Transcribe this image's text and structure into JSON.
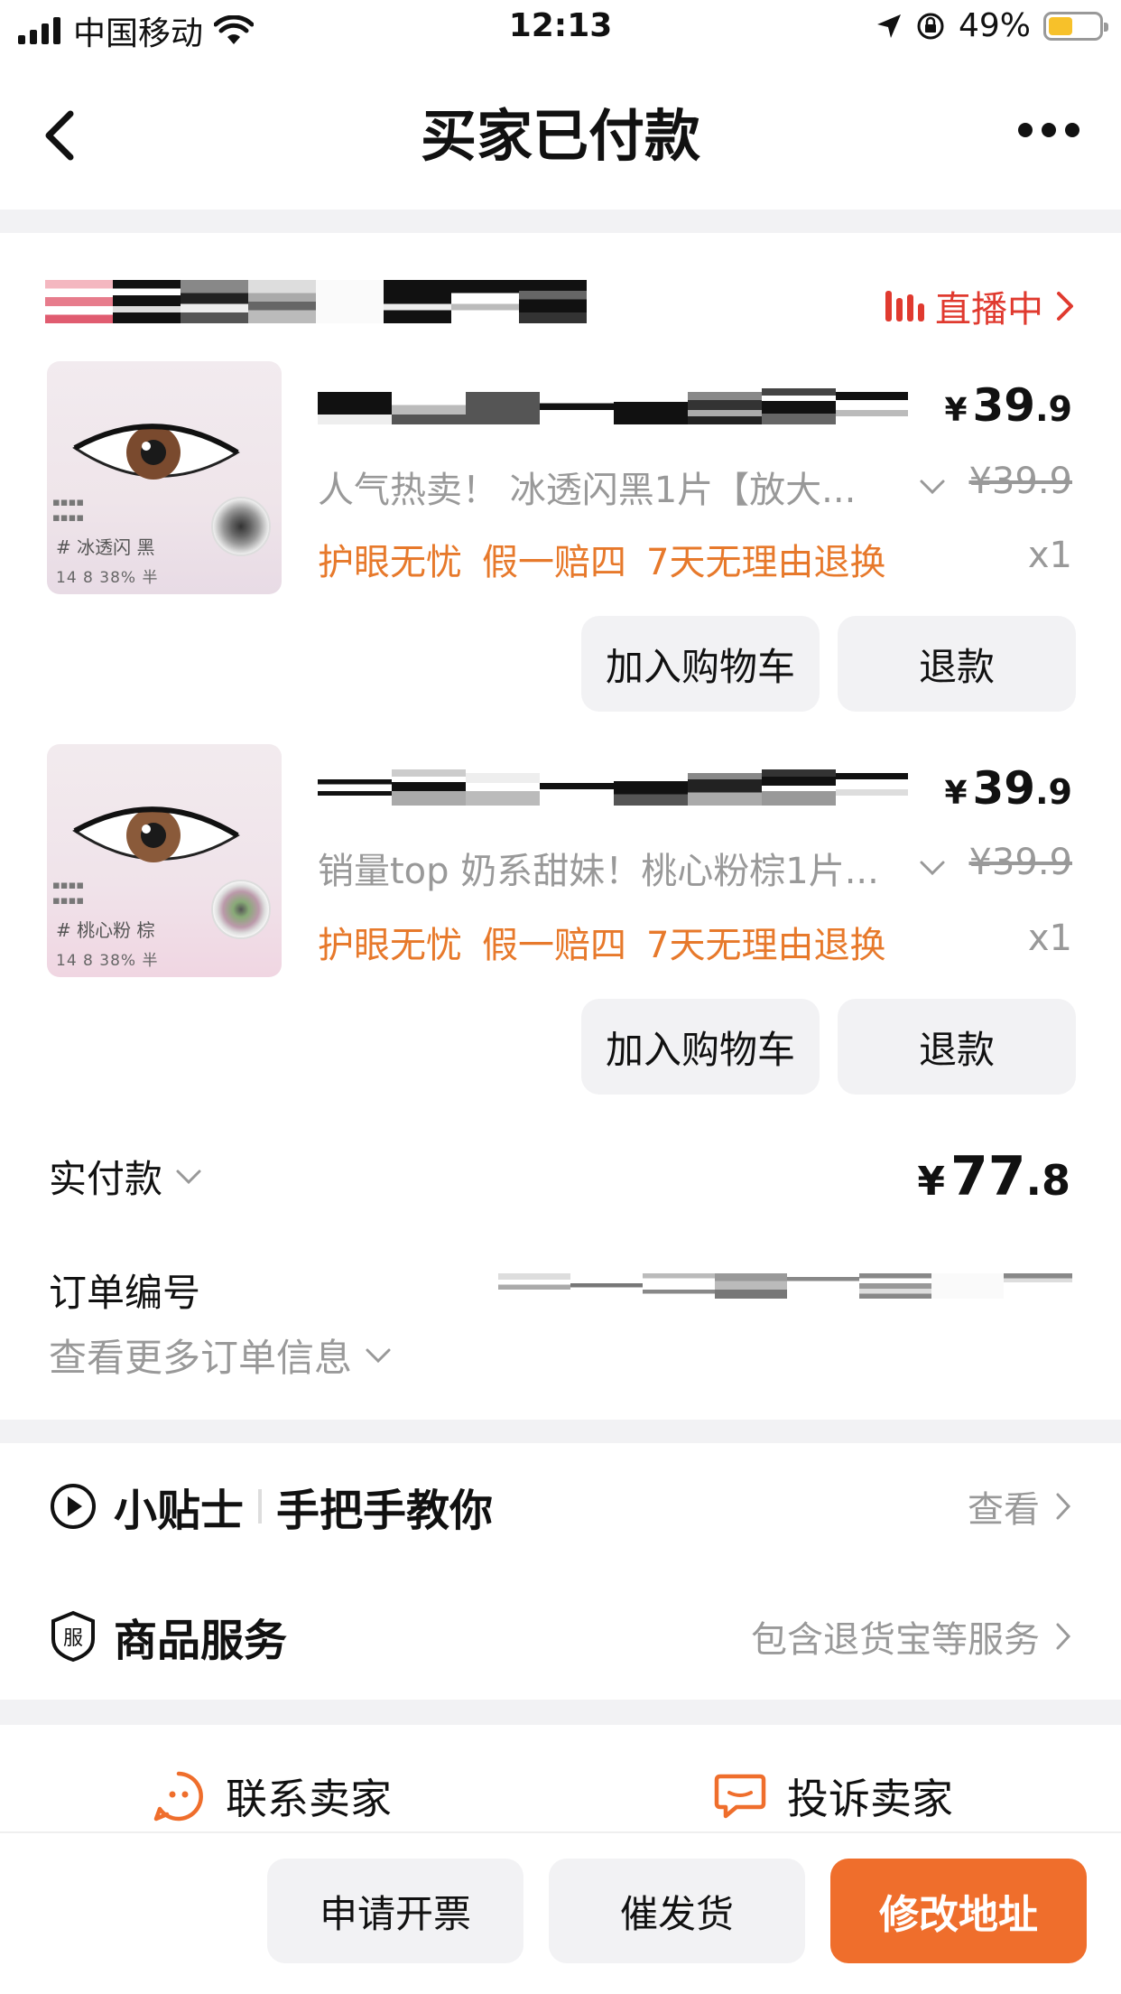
{
  "status_bar": {
    "carrier": "中国移动",
    "time": "12:13",
    "battery": "49%",
    "battery_level": 0.49
  },
  "nav": {
    "title": "买家已付款"
  },
  "shop": {
    "live_label": "直播中"
  },
  "products": [
    {
      "price_int": "39",
      "price_dec": ".9",
      "currency": "¥",
      "sku": "人气热卖！ 冰透闪黑1片【放大...",
      "original_price": "¥39.9",
      "tags": [
        "护眼无忧",
        "假一赔四",
        "7天无理由退换"
      ],
      "quantity": "x1",
      "image_label": "# 冰透闪 黑",
      "image_stats": "14  8  38%  半",
      "add_cart_label": "加入购物车",
      "refund_label": "退款"
    },
    {
      "price_int": "39",
      "price_dec": ".9",
      "currency": "¥",
      "sku": "销量top 奶系甜妹！桃心粉棕1片...",
      "original_price": "¥39.9",
      "tags": [
        "护眼无忧",
        "假一赔四",
        "7天无理由退换"
      ],
      "quantity": "x1",
      "image_label": "# 桃心粉 棕",
      "image_stats": "14  8  38%  半",
      "add_cart_label": "加入购物车",
      "refund_label": "退款"
    }
  ],
  "payment": {
    "label": "实付款",
    "currency": "¥",
    "amount_int": "77",
    "amount_dec": ".8"
  },
  "order": {
    "number_label": "订单编号",
    "more_info_label": "查看更多订单信息"
  },
  "tips": {
    "title": "小贴士",
    "subtitle": "手把手教你",
    "link": "查看"
  },
  "service": {
    "icon_char": "服",
    "title": "商品服务",
    "link": "包含退货宝等服务"
  },
  "contact": {
    "contact_seller": "联系卖家",
    "complain_seller": "投诉卖家"
  },
  "bottom": {
    "invoice": "申请开票",
    "urge": "催发货",
    "modify_address": "修改地址"
  }
}
